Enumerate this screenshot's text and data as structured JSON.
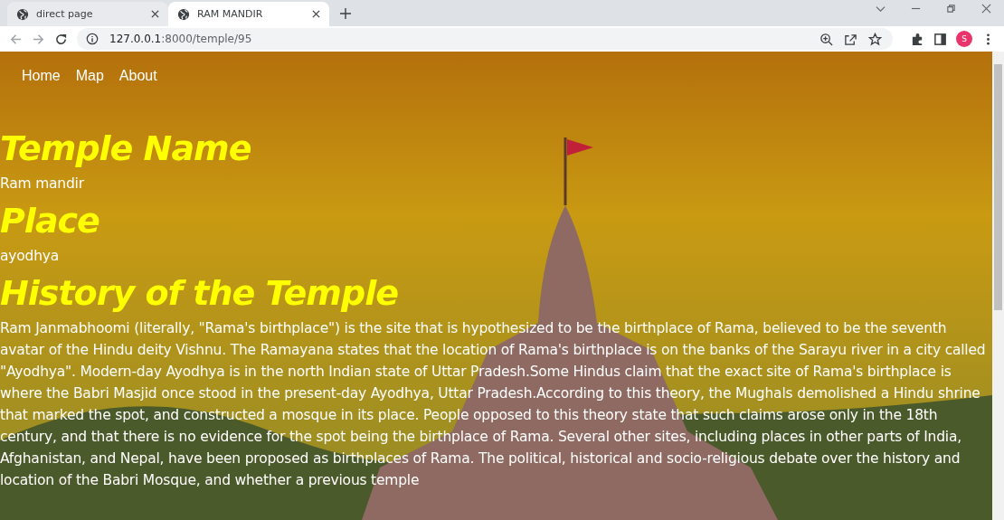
{
  "browser": {
    "tabs": [
      {
        "title": "direct page",
        "selected": false
      },
      {
        "title": "RAM MANDIR",
        "selected": true
      }
    ],
    "address": {
      "host": "127.0.0.1",
      "path": ":8000/temple/95"
    },
    "profile_initial": "S"
  },
  "nav": [
    "Home",
    "Map",
    "About"
  ],
  "sections": [
    {
      "heading": "Temple Name",
      "text": "Ram mandir"
    },
    {
      "heading": "Place",
      "text": "ayodhya"
    },
    {
      "heading": "History of the Temple",
      "text": "Ram Janmabhoomi (literally, \"Rama's birthplace\") is the site that is hypothesized to be the birthplace of Rama, believed to be the seventh avatar of the Hindu deity Vishnu. The Ramayana states that the location of Rama's birthplace is on the banks of the Sarayu river in a city called \"Ayodhya\". Modern-day Ayodhya is in the north Indian state of Uttar Pradesh.Some Hindus claim that the exact site of Rama's birthplace is where the Babri Masjid once stood in the present-day Ayodhya, Uttar Pradesh.According to this theory, the Mughals demolished a Hindu shrine that marked the spot, and constructed a mosque in its place. People opposed to this theory state that such claims arose only in the 18th century, and that there is no evidence for the spot being the birthplace of Rama. Several other sites, including places in other parts of India, Afghanistan, and Nepal, have been proposed as birthplaces of Rama. The political, historical and socio-religious debate over the history and location of the Babri Mosque, and whether a previous temple"
    }
  ]
}
